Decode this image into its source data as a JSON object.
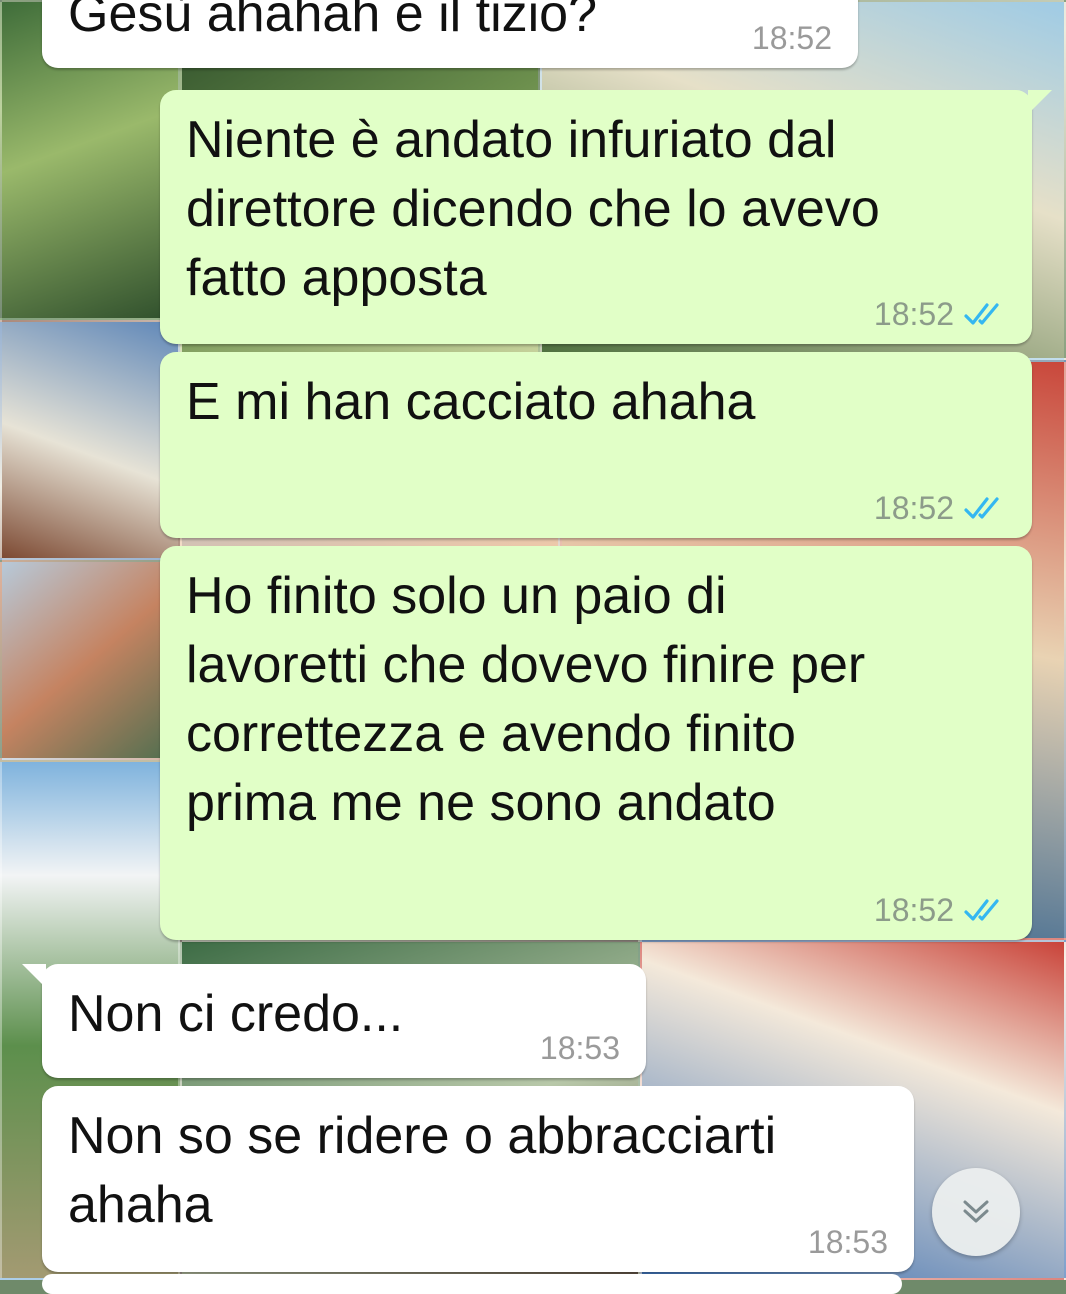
{
  "chat": {
    "messages": [
      {
        "id": "b1",
        "direction": "incoming",
        "text": "Gesù ahahah e il tizio?",
        "time": "18:52"
      },
      {
        "id": "b2",
        "direction": "outgoing",
        "text": "Niente è andato infuriato dal\ndirettore dicendo che lo avevo\nfatto apposta",
        "time": "18:52",
        "status": "read"
      },
      {
        "id": "b3",
        "direction": "outgoing",
        "text": "E mi han cacciato ahaha",
        "time": "18:52",
        "status": "read"
      },
      {
        "id": "b4",
        "direction": "outgoing",
        "text": "Ho finito solo un paio di\nlavoretti che dovevo finire per\ncorrettezza e avendo finito\nprima me ne sono andato",
        "time": "18:52",
        "status": "read"
      },
      {
        "id": "b5",
        "direction": "incoming",
        "text": "Non ci credo...",
        "time": "18:53"
      },
      {
        "id": "b6",
        "direction": "incoming",
        "text": "Non so se ridere o abbracciarti\nahaha",
        "time": "18:53"
      }
    ]
  },
  "colors": {
    "outgoing_bubble": "#e1ffc7",
    "incoming_bubble": "#ffffff",
    "read_ticks": "#34b7f1"
  },
  "icons": {
    "read_receipt": "double-check-icon",
    "scroll_down": "chevron-double-down-icon"
  }
}
